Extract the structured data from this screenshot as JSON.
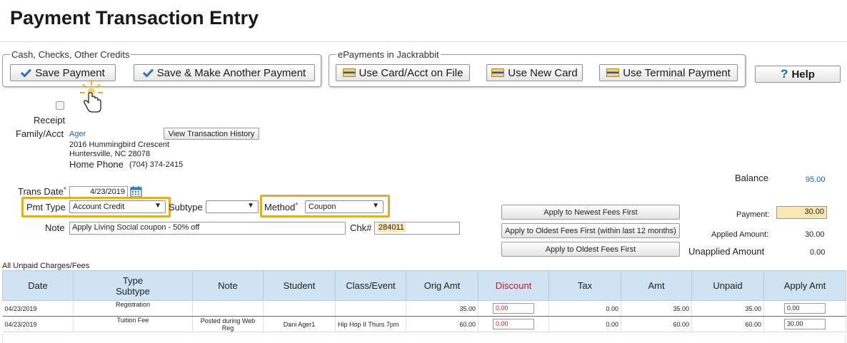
{
  "page_title": "Payment Transaction Entry",
  "cash_group": {
    "legend": "Cash, Checks, Other Credits",
    "save_payment": "Save Payment",
    "save_make_another": "Save & Make Another Payment"
  },
  "epayments_group": {
    "legend": "ePayments in Jackrabbit",
    "use_card_on_file": "Use Card/Acct on File",
    "use_new_card": "Use New Card",
    "use_terminal": "Use Terminal Payment"
  },
  "help_label": "Help",
  "receipt_label": "Receipt",
  "family": {
    "label": "Family/Acct",
    "name": "Ager",
    "view_history": "View Transaction History",
    "address1": "2016 Hummingbird Crescent",
    "address2": "Huntersville, NC  28078",
    "phone_label": "Home Phone",
    "phone": "(704) 374-2415"
  },
  "form": {
    "trans_date_label": "Trans Date",
    "trans_date": "4/23/2019",
    "pmt_type_label": "Pmt Type",
    "pmt_type": "Account Credit",
    "subtype_label": "Subtype",
    "subtype": "",
    "method_label": "Method",
    "method": "Coupon",
    "note_label": "Note",
    "note": "Apply Living Social coupon - 50% off",
    "chk_label": "Chk#",
    "chk": "284011",
    "required_mark": "*"
  },
  "apply_buttons": {
    "newest": "Apply to Newest Fees First",
    "oldest12": "Apply to Oldest Fees First (within last 12 months)",
    "oldest": "Apply to Oldest Fees First"
  },
  "totals": {
    "balance_label": "Balance",
    "balance": "95.00",
    "payment_label": "Payment:",
    "payment": "30.00",
    "applied_label": "Applied Amount:",
    "applied": "30.00",
    "unapplied_label": "Unapplied Amount",
    "unapplied": "0.00"
  },
  "table": {
    "caption": "All Unpaid Charges/Fees",
    "headers": {
      "date": "Date",
      "type": "Type",
      "subtype": "Subtype",
      "note": "Note",
      "student": "Student",
      "class": "Class/Event",
      "orig": "Orig Amt",
      "discount": "Discount",
      "tax": "Tax",
      "amt": "Amt",
      "unpaid": "Unpaid",
      "apply": "Apply Amt"
    },
    "rows": [
      {
        "date": "04/23/2019",
        "type": "Registration",
        "note": "",
        "student": "",
        "class": "",
        "orig": "35.00",
        "discount": "0.00",
        "tax": "0.00",
        "amt": "35.00",
        "unpaid": "35.00",
        "apply": "0.00"
      },
      {
        "date": "04/23/2019",
        "type": "Tuition Fee",
        "note": "Posted during Web Reg",
        "student": "Dani Ager1",
        "class": "Hip Hop II Thurs 7pm",
        "orig": "60.00",
        "discount": "0.00",
        "tax": "0.00",
        "amt": "60.00",
        "unpaid": "60.00",
        "apply": "30.00"
      }
    ]
  },
  "colors": {
    "accent_blue": "#1a64b0",
    "highlight_orange": "#e7ac1f",
    "header_blue": "#cfe3f3",
    "input_highlight": "#fbe6b4",
    "discount_red": "#c0202a"
  },
  "icons": [
    "check-icon",
    "card-icon",
    "help-icon",
    "calendar-icon",
    "hand-cursor-icon"
  ]
}
